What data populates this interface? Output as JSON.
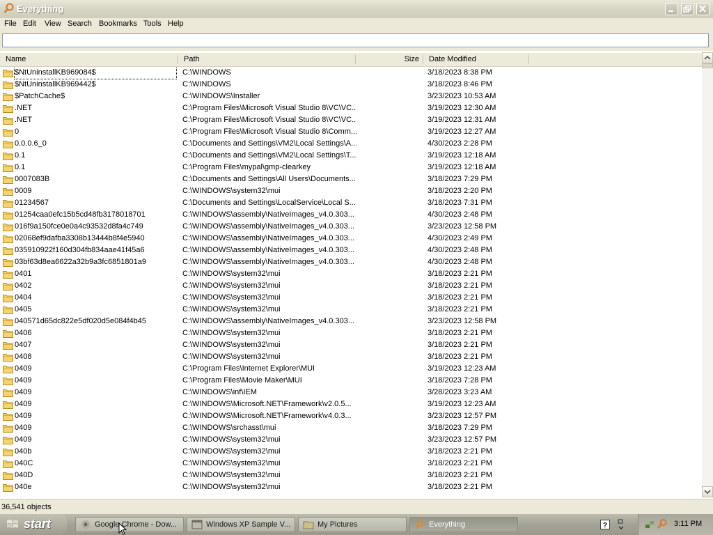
{
  "window": {
    "title": "Everything"
  },
  "menu": [
    "File",
    "Edit",
    "View",
    "Search",
    "Bookmarks",
    "Tools",
    "Help"
  ],
  "search": {
    "value": "",
    "placeholder": ""
  },
  "columns": {
    "name": "Name",
    "path": "Path",
    "size": "Size",
    "date": "Date Modified"
  },
  "rows": [
    {
      "name": "$NtUninstallKB969084$",
      "path": "C:\\WINDOWS",
      "date": "3/18/2023 8:38 PM"
    },
    {
      "name": "$NtUninstallKB969442$",
      "path": "C:\\WINDOWS",
      "date": "3/18/2023 8:46 PM"
    },
    {
      "name": "$PatchCache$",
      "path": "C:\\WINDOWS\\Installer",
      "date": "3/23/2023 10:53 AM"
    },
    {
      "name": ".NET",
      "path": "C:\\Program Files\\Microsoft Visual Studio 8\\VC\\VC...",
      "date": "3/19/2023 12:30 AM"
    },
    {
      "name": ".NET",
      "path": "C:\\Program Files\\Microsoft Visual Studio 8\\VC\\VC...",
      "date": "3/19/2023 12:31 AM"
    },
    {
      "name": "0",
      "path": "C:\\Program Files\\Microsoft Visual Studio 8\\Comm...",
      "date": "3/19/2023 12:27 AM"
    },
    {
      "name": "0.0.0.6_0",
      "path": "C:\\Documents and Settings\\VM2\\Local Settings\\A...",
      "date": "4/30/2023 2:28 PM"
    },
    {
      "name": "0.1",
      "path": "C:\\Documents and Settings\\VM2\\Local Settings\\T...",
      "date": "3/19/2023 12:18 AM"
    },
    {
      "name": "0.1",
      "path": "C:\\Program Files\\mypal\\gmp-clearkey",
      "date": "3/19/2023 12:18 AM"
    },
    {
      "name": "0007083B",
      "path": "C:\\Documents and Settings\\All Users\\Documents...",
      "date": "3/18/2023 7:29 PM"
    },
    {
      "name": "0009",
      "path": "C:\\WINDOWS\\system32\\mui",
      "date": "3/18/2023 2:20 PM"
    },
    {
      "name": "01234567",
      "path": "C:\\Documents and Settings\\LocalService\\Local S...",
      "date": "3/18/2023 7:31 PM"
    },
    {
      "name": "01254caa0efc15b5cd48fb3178018701",
      "path": "C:\\WINDOWS\\assembly\\NativeImages_v4.0.303...",
      "date": "4/30/2023 2:48 PM"
    },
    {
      "name": "016f9a150fce0e0a4c93532d8fa4c749",
      "path": "C:\\WINDOWS\\assembly\\NativeImages_v4.0.303...",
      "date": "3/23/2023 12:58 PM"
    },
    {
      "name": "02068ef9dafba3308b13444b8f4e5940",
      "path": "C:\\WINDOWS\\assembly\\NativeImages_v4.0.303...",
      "date": "4/30/2023 2:49 PM"
    },
    {
      "name": "035910922f160d304fb834aae41f45a6",
      "path": "C:\\WINDOWS\\assembly\\NativeImages_v4.0.303...",
      "date": "4/30/2023 2:48 PM"
    },
    {
      "name": "03bf63d8ea6622a32b9a3fc6851801a9",
      "path": "C:\\WINDOWS\\assembly\\NativeImages_v4.0.303...",
      "date": "4/30/2023 2:48 PM"
    },
    {
      "name": "0401",
      "path": "C:\\WINDOWS\\system32\\mui",
      "date": "3/18/2023 2:21 PM"
    },
    {
      "name": "0402",
      "path": "C:\\WINDOWS\\system32\\mui",
      "date": "3/18/2023 2:21 PM"
    },
    {
      "name": "0404",
      "path": "C:\\WINDOWS\\system32\\mui",
      "date": "3/18/2023 2:21 PM"
    },
    {
      "name": "0405",
      "path": "C:\\WINDOWS\\system32\\mui",
      "date": "3/18/2023 2:21 PM"
    },
    {
      "name": "040571d65dc822e5df020d5e084f4b45",
      "path": "C:\\WINDOWS\\assembly\\NativeImages_v4.0.303...",
      "date": "3/23/2023 12:58 PM"
    },
    {
      "name": "0406",
      "path": "C:\\WINDOWS\\system32\\mui",
      "date": "3/18/2023 2:21 PM"
    },
    {
      "name": "0407",
      "path": "C:\\WINDOWS\\system32\\mui",
      "date": "3/18/2023 2:21 PM"
    },
    {
      "name": "0408",
      "path": "C:\\WINDOWS\\system32\\mui",
      "date": "3/18/2023 2:21 PM"
    },
    {
      "name": "0409",
      "path": "C:\\Program Files\\Internet Explorer\\MUI",
      "date": "3/19/2023 12:23 AM"
    },
    {
      "name": "0409",
      "path": "C:\\Program Files\\Movie Maker\\MUI",
      "date": "3/18/2023 7:28 PM"
    },
    {
      "name": "0409",
      "path": "C:\\WINDOWS\\inf\\IEM",
      "date": "3/28/2023 3:23 AM"
    },
    {
      "name": "0409",
      "path": "C:\\WINDOWS\\Microsoft.NET\\Framework\\v2.0.5...",
      "date": "3/19/2023 12:23 AM"
    },
    {
      "name": "0409",
      "path": "C:\\WINDOWS\\Microsoft.NET\\Framework\\v4.0.3...",
      "date": "3/23/2023 12:57 PM"
    },
    {
      "name": "0409",
      "path": "C:\\WINDOWS\\srchasst\\mui",
      "date": "3/18/2023 7:29 PM"
    },
    {
      "name": "0409",
      "path": "C:\\WINDOWS\\system32\\mui",
      "date": "3/23/2023 12:57 PM"
    },
    {
      "name": "040b",
      "path": "C:\\WINDOWS\\system32\\mui",
      "date": "3/18/2023 2:21 PM"
    },
    {
      "name": "040C",
      "path": "C:\\WINDOWS\\system32\\mui",
      "date": "3/18/2023 2:21 PM"
    },
    {
      "name": "040D",
      "path": "C:\\WINDOWS\\system32\\mui",
      "date": "3/18/2023 2:21 PM"
    },
    {
      "name": "040e",
      "path": "C:\\WINDOWS\\system32\\mui",
      "date": "3/18/2023 2:21 PM"
    }
  ],
  "status": {
    "text": "36,541 objects"
  },
  "taskbar": {
    "start_label": "start",
    "tasks": [
      {
        "label": "Google Chrome - Dow...",
        "icon": "chrome-icon",
        "active": false
      },
      {
        "label": "Windows XP Sample V...",
        "icon": "window-icon",
        "active": false
      },
      {
        "label": "My Pictures",
        "icon": "folder-icon",
        "active": false
      },
      {
        "label": "Everything",
        "icon": "search-icon",
        "active": true
      }
    ],
    "clock": "3:11 PM"
  },
  "colors": {
    "selection": "#316ac5",
    "folder": "#f3d56f",
    "title_text": "#ffffff"
  }
}
